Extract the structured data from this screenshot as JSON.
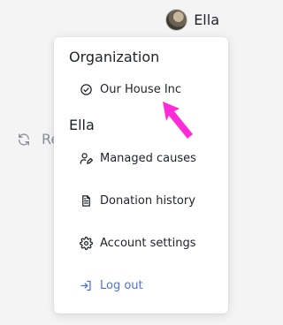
{
  "user": {
    "name": "Ella",
    "avatar_icon": "user-avatar"
  },
  "background": {
    "refresh_label": "Re",
    "refresh_icon": "refresh-icon"
  },
  "menu": {
    "organization_header": "Organization",
    "organization_item": {
      "label": "Our House Inc",
      "icon": "check-circle-icon"
    },
    "user_header": "Ella",
    "items": [
      {
        "label": "Managed causes",
        "icon": "user-edit-icon"
      },
      {
        "label": "Donation history",
        "icon": "document-icon"
      },
      {
        "label": "Account settings",
        "icon": "gear-icon"
      },
      {
        "label": "Log out",
        "icon": "logout-icon"
      }
    ]
  },
  "colors": {
    "accent_link": "#4a72d8",
    "annotation_arrow": "#ff2bd6"
  }
}
